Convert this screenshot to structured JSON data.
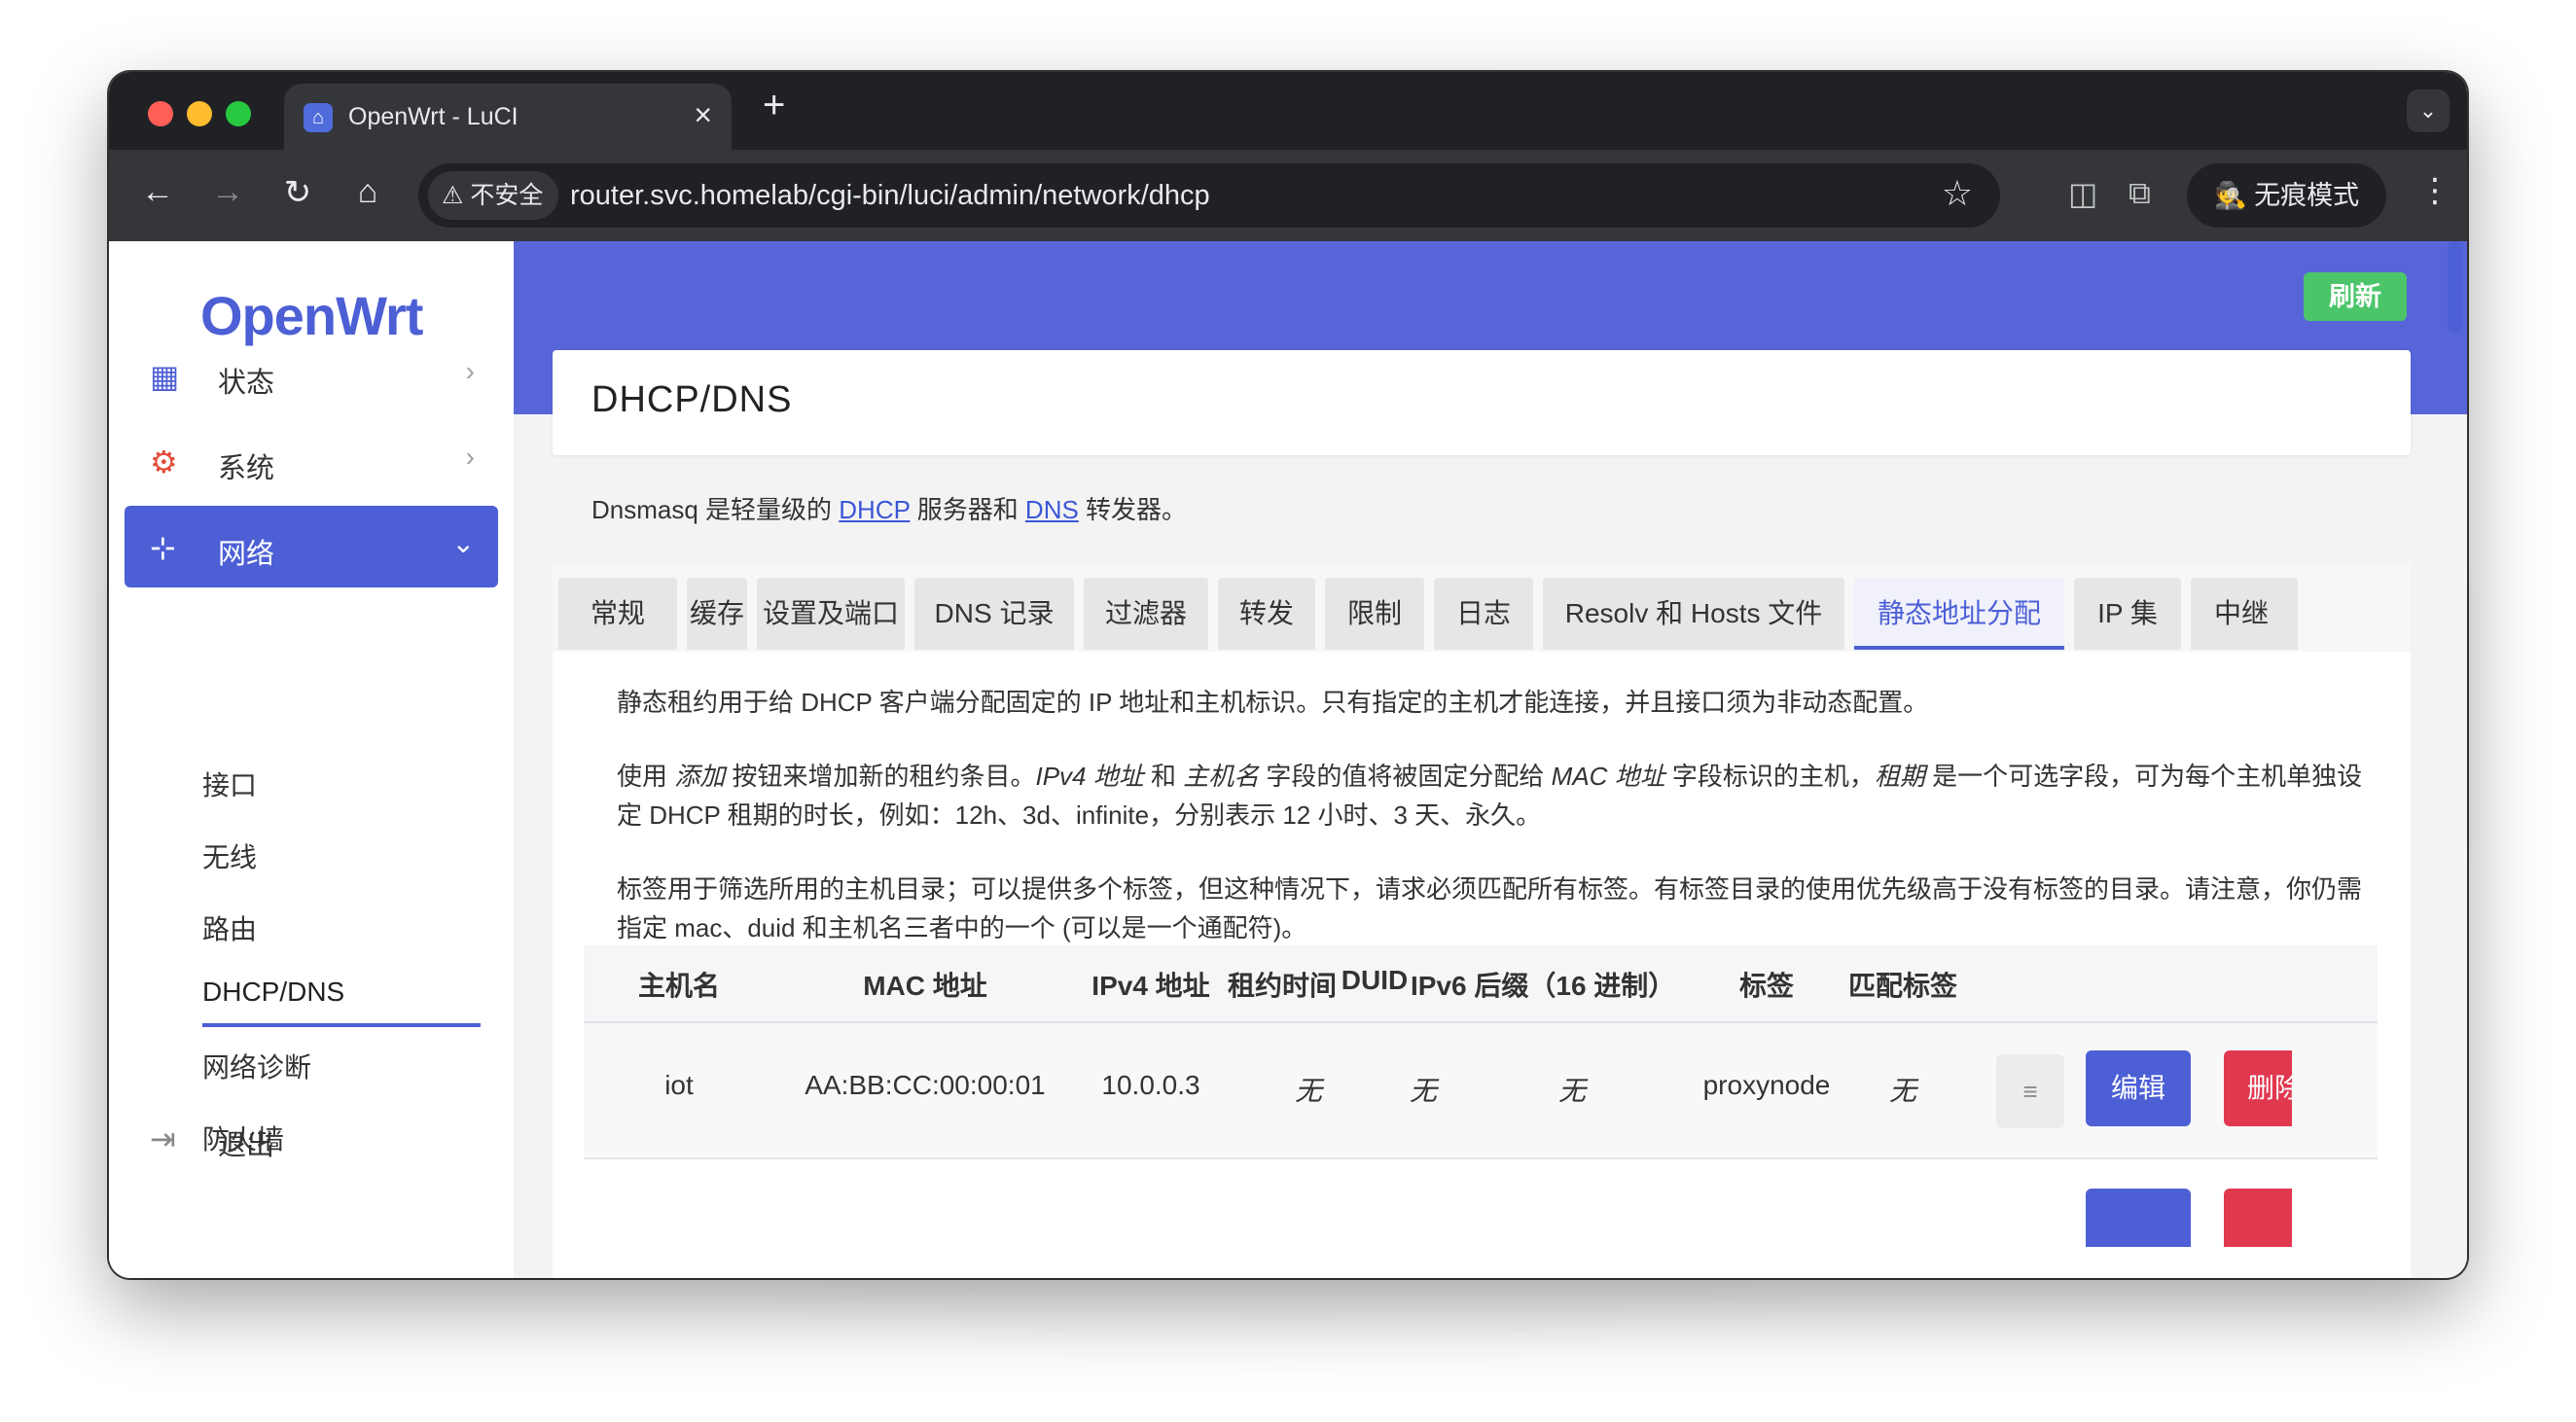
{
  "browser": {
    "tab_title": "OpenWrt - LuCI",
    "favicon": "openwrt-favicon",
    "new_tab_symbol": "+",
    "close_symbol": "×",
    "security_label": "不安全",
    "url": "router.svc.homelab/cgi-bin/luci/admin/network/dhcp",
    "profile_label": "无痕模式"
  },
  "sidebar": {
    "logo": "OpenWrt",
    "items": [
      {
        "label": "状态",
        "icon": "dashboard-icon"
      },
      {
        "label": "系统",
        "icon": "gear-icon"
      },
      {
        "label": "网络",
        "icon": "network-icon"
      },
      {
        "label": "退出",
        "icon": "logout-icon"
      }
    ],
    "network_sub": [
      "接口",
      "无线",
      "路由",
      "DHCP/DNS",
      "网络诊断",
      "防火墙"
    ]
  },
  "header": {
    "refresh_label": "刷新",
    "page_title": "DHCP/DNS"
  },
  "description": {
    "prefix": "Dnsmasq 是轻量级的 ",
    "link1": "DHCP",
    "middle": " 服务器和 ",
    "link2": "DNS",
    "suffix": " 转发器。"
  },
  "tabs": [
    "常规",
    "缓存",
    "设置及端口",
    "DNS 记录",
    "过滤器",
    "转发",
    "限制",
    "日志",
    "Resolv 和 Hosts 文件",
    "静态地址分配",
    "IP 集",
    "中继"
  ],
  "active_tab": "静态地址分配",
  "content": {
    "p1": "静态租约用于给 DHCP 客户端分配固定的 IP 地址和主机标识。只有指定的主机才能连接，并且接口须为非动态配置。",
    "p2_parts": [
      "使用 ",
      "添加",
      " 按钮来增加新的租约条目。",
      "IPv4 地址",
      " 和 ",
      "主机名",
      " 字段的值将被固定分配给 ",
      "MAC 地址",
      " 字段标识的主机，",
      "租期",
      " 是一个可选字段，可为每个主机单独设定 DHCP 租期的时长，例如：12h、3d、infinite，分别表示 12 小时、3 天、永久。"
    ],
    "p3": "标签用于筛选所用的主机目录；可以提供多个标签，但这种情况下，请求必须匹配所有标签。有标签目录的使用优先级高于没有标签的目录。请注意，你仍需指定 mac、duid 和主机名三者中的一个 (可以是一个通配符)。"
  },
  "table": {
    "columns": [
      "主机名",
      "MAC 地址",
      "IPv4 地址",
      "租约时间",
      "DUID",
      "IPv6 后缀（16 进制）",
      "标签",
      "匹配标签"
    ],
    "rows": [
      {
        "hostname": "iot",
        "mac": "AA:BB:CC:00:00:01",
        "ipv4": "10.0.0.3",
        "lease": "无",
        "duid": "无",
        "ipv6": "无",
        "tag": "proxynode",
        "match_tag": "无"
      }
    ],
    "drag_symbol": "≡",
    "edit_label": "编辑",
    "delete_label": "删除"
  }
}
